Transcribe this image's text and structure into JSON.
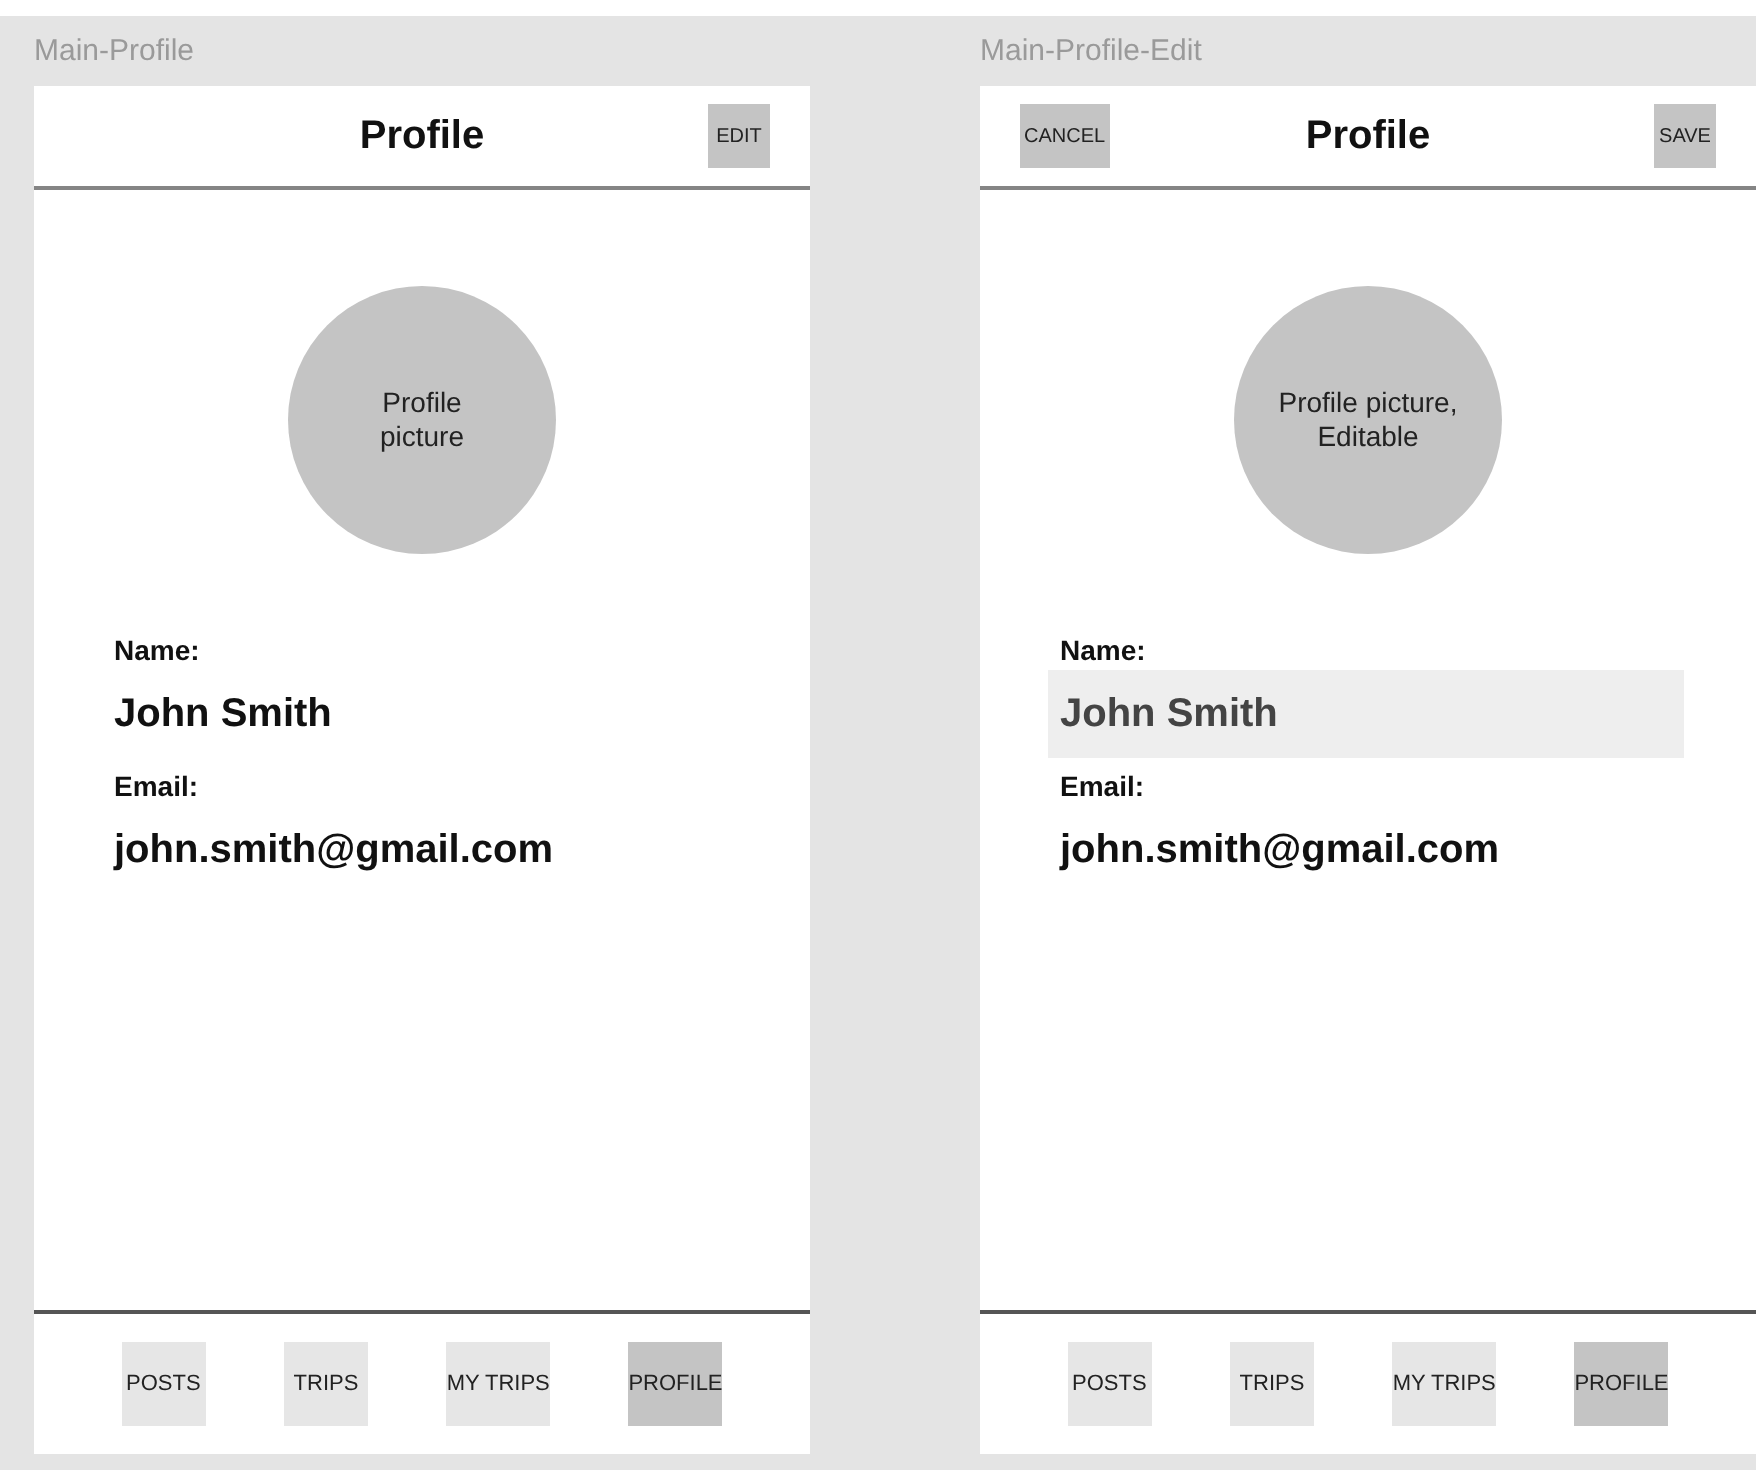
{
  "screens": [
    {
      "frame_label": "Main-Profile",
      "title": "Profile",
      "right_action": "EDIT",
      "avatar_lines": [
        "Profile",
        "picture"
      ],
      "fields": [
        {
          "label": "Name:",
          "value": "John Smith",
          "editable": false
        },
        {
          "label": "Email:",
          "value": "john.smith@gmail.com",
          "editable": false
        }
      ],
      "nav": [
        {
          "label": "POSTS",
          "selected": false
        },
        {
          "label": "TRIPS",
          "selected": false
        },
        {
          "label": "MY TRIPS",
          "selected": false
        },
        {
          "label": "PROFILE",
          "selected": true
        }
      ]
    },
    {
      "frame_label": "Main-Profile-Edit",
      "title": "Profile",
      "left_action": "CANCEL",
      "right_action": "SAVE",
      "avatar_lines": [
        "Profile picture,",
        "Editable"
      ],
      "fields": [
        {
          "label": "Name:",
          "value": "John Smith",
          "editable": true
        },
        {
          "label": "Email:",
          "value": "john.smith@gmail.com",
          "editable": false
        }
      ],
      "nav": [
        {
          "label": "POSTS",
          "selected": false
        },
        {
          "label": "TRIPS",
          "selected": false
        },
        {
          "label": "MY TRIPS",
          "selected": false
        },
        {
          "label": "PROFILE",
          "selected": true
        }
      ]
    }
  ]
}
